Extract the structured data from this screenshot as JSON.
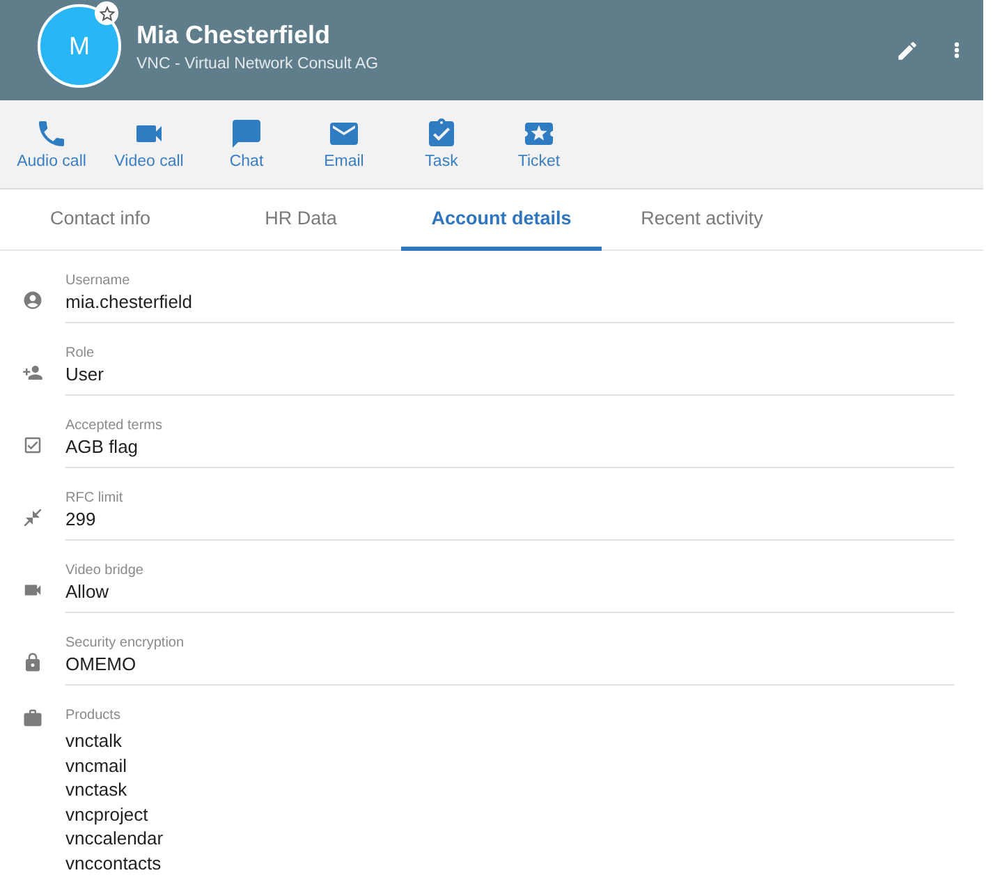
{
  "header": {
    "avatar_initial": "M",
    "favorite": false,
    "name": "Mia Chesterfield",
    "company": "VNC - Virtual Network Consult AG"
  },
  "actions": [
    {
      "kind": "audio",
      "label": "Audio call"
    },
    {
      "kind": "video",
      "label": "Video call"
    },
    {
      "kind": "chat",
      "label": "Chat"
    },
    {
      "kind": "email",
      "label": "Email"
    },
    {
      "kind": "task",
      "label": "Task"
    },
    {
      "kind": "ticket",
      "label": "Ticket"
    }
  ],
  "tabs": [
    {
      "label": "Contact info",
      "selected": false
    },
    {
      "label": "HR Data",
      "selected": false
    },
    {
      "label": "Account details",
      "selected": true
    },
    {
      "label": "Recent activity",
      "selected": false
    }
  ],
  "fields": [
    {
      "kind": "username",
      "label": "Username",
      "value": "mia.chesterfield"
    },
    {
      "kind": "role",
      "label": "Role",
      "value": "User"
    },
    {
      "kind": "terms",
      "label": "Accepted terms",
      "value": "AGB flag"
    },
    {
      "kind": "limit",
      "label": "RFC limit",
      "value": "299"
    },
    {
      "kind": "video",
      "label": "Video bridge",
      "value": "Allow"
    },
    {
      "kind": "security",
      "label": "Security encryption",
      "value": "OMEMO"
    },
    {
      "kind": "products",
      "label": "Products",
      "values": [
        "vnctalk",
        "vncmail",
        "vnctask",
        "vncproject",
        "vnccalendar",
        "vnccontacts"
      ]
    }
  ]
}
